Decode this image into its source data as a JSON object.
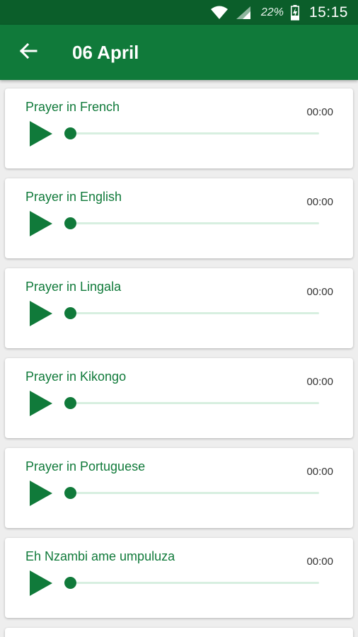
{
  "status_bar": {
    "battery_percent": "22%",
    "time": "15:15",
    "icons": [
      "wifi-icon",
      "signal-icon",
      "battery-charging-icon"
    ]
  },
  "app_bar": {
    "back_icon": "arrow-left-icon",
    "title": "06 April"
  },
  "prayers": [
    {
      "title": "Prayer in French",
      "time": "00:00",
      "progress": 0
    },
    {
      "title": "Prayer in English",
      "time": "00:00",
      "progress": 0
    },
    {
      "title": "Prayer in Lingala",
      "time": "00:00",
      "progress": 0
    },
    {
      "title": "Prayer in Kikongo",
      "time": "00:00",
      "progress": 0
    },
    {
      "title": "Prayer in Portuguese",
      "time": "00:00",
      "progress": 0
    },
    {
      "title": "Eh Nzambi ame umpuluza",
      "time": "00:00",
      "progress": 0
    }
  ],
  "colors": {
    "status_bar": "#0b5e2a",
    "app_bar": "#107a3a",
    "accent": "#107a3a",
    "track": "#d7efe0",
    "background": "#eeeeee"
  }
}
